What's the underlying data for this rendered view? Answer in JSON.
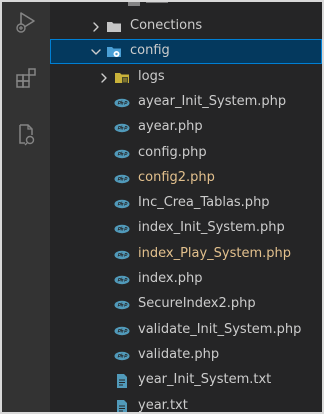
{
  "explorer": {
    "items": [
      {
        "label": "Conections",
        "kind": "folder",
        "level": 1,
        "expanded": false
      },
      {
        "label": "config",
        "kind": "folder-config",
        "level": 1,
        "expanded": true,
        "selected": true
      },
      {
        "label": "logs",
        "kind": "folder-logs",
        "level": 2,
        "expanded": false
      },
      {
        "label": "ayear_Init_System.php",
        "kind": "php",
        "level": 2
      },
      {
        "label": "ayear.php",
        "kind": "php",
        "level": 2
      },
      {
        "label": "config.php",
        "kind": "php",
        "level": 2
      },
      {
        "label": "config2.php",
        "kind": "php",
        "level": 2,
        "modified": true
      },
      {
        "label": "Inc_Crea_Tablas.php",
        "kind": "php",
        "level": 2
      },
      {
        "label": "index_Init_System.php",
        "kind": "php",
        "level": 2
      },
      {
        "label": "index_Play_System.php",
        "kind": "php",
        "level": 2,
        "modified": true
      },
      {
        "label": "index.php",
        "kind": "php",
        "level": 2
      },
      {
        "label": "SecureIndex2.php",
        "kind": "php",
        "level": 2
      },
      {
        "label": "validate_Init_System.php",
        "kind": "php",
        "level": 2
      },
      {
        "label": "validate.php",
        "kind": "php",
        "level": 2
      },
      {
        "label": "year_Init_System.txt",
        "kind": "txt",
        "level": 2
      },
      {
        "label": "year.txt",
        "kind": "txt",
        "level": 2
      }
    ]
  },
  "activity_bar": {
    "icons": [
      "run-debug-icon",
      "extensions-icon",
      "remote-explorer-icon"
    ]
  },
  "colors": {
    "sidebar_bg": "#252526",
    "activity_bg": "#333333",
    "text": "#cccccc",
    "modified_text": "#e2c08d",
    "selection_bg": "#04395e",
    "selection_border": "#007fd4",
    "php_icon": "#519aba",
    "folder_icon": "#c5c5c5",
    "config_folder_icon": "#4a9fd6",
    "logs_folder_icon": "#c9b23a",
    "txt_icon": "#6d8086"
  }
}
